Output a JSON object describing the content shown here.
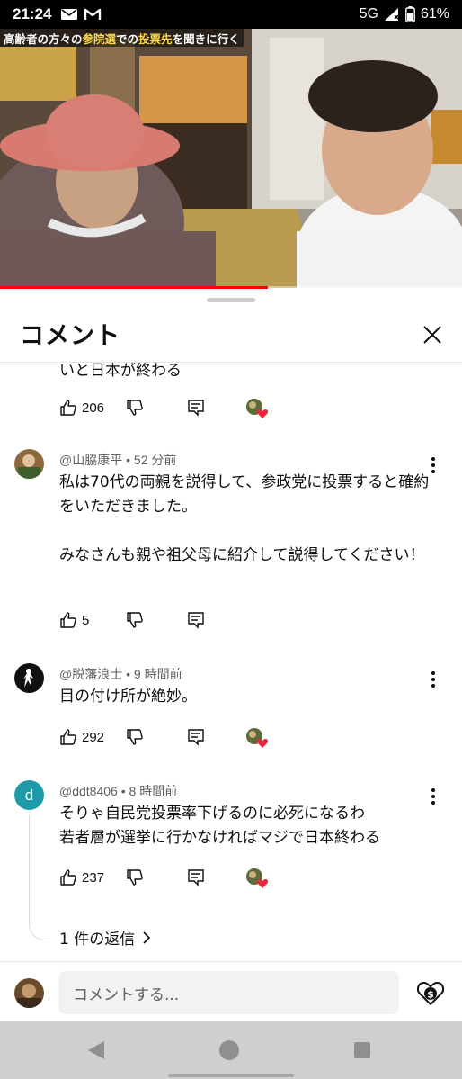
{
  "status_bar": {
    "time": "21:24",
    "network": "5G",
    "battery": "61%"
  },
  "video": {
    "caption_parts": [
      {
        "text": "高齢者の方々の",
        "highlight": false
      },
      {
        "text": "参院選",
        "highlight": true
      },
      {
        "text": "での",
        "highlight": false
      },
      {
        "text": "投票先",
        "highlight": true
      },
      {
        "text": "を聞きに行く",
        "highlight": false
      }
    ],
    "progress": 0.58
  },
  "sheet": {
    "title": "コメント"
  },
  "truncated_comment": {
    "text_tail": "いと日本が終わる",
    "likes": "206",
    "creator_hearted": true
  },
  "comments": [
    {
      "author": "@山脇康平",
      "time": "52 分前",
      "body": "私は70代の両親を説得して、参政党に投票すると確約をいただきました。\n\nみなさんも親や祖父母に紹介して説得してください！",
      "likes": "5",
      "creator_hearted": false,
      "avatar_color": "#8b6a3e"
    },
    {
      "author": "@脱藩浪士",
      "time": "9 時間前",
      "body": "目の付け所が絶妙。",
      "likes": "292",
      "creator_hearted": true,
      "avatar_color": "#111111"
    },
    {
      "author": "@ddt8406",
      "time": "8 時間前",
      "body": "そりゃ自民党投票率下げるのに必死になるわ\n若者層が選挙に行かなければマジで日本終わる",
      "likes": "237",
      "creator_hearted": true,
      "avatar_letter": "d",
      "avatar_color": "#1e9aa8",
      "replies_label": "1 件の返信"
    }
  ],
  "compose": {
    "placeholder": "コメントする..."
  },
  "colors": {
    "accent_red": "#ff0000",
    "heart_red": "#e8283c",
    "text_primary": "#0f0f0f",
    "text_secondary": "#606060"
  }
}
